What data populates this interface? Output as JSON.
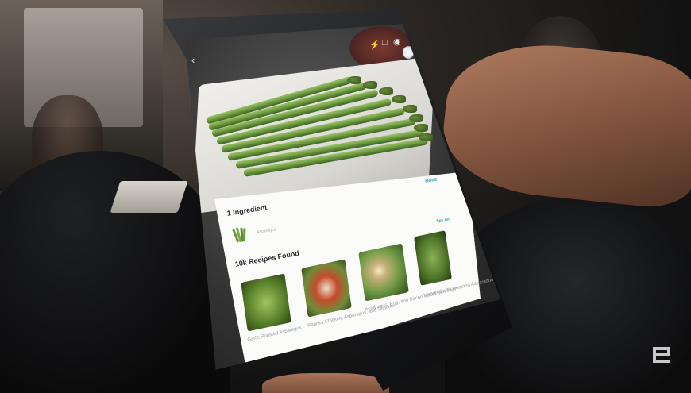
{
  "app": {
    "ingredients_heading": "1 Ingredient",
    "ingredient_name": "Asparagus",
    "see_all_label": "See All",
    "top_right_label": "MORE",
    "recipes_heading": "10k Recipes Found",
    "back_icon": "chevron-left-icon",
    "toolbar_icons": [
      "flash-icon",
      "square-icon",
      "settings-icon"
    ],
    "recipes": [
      {
        "caption": "Garlic Roasted Asparagus"
      },
      {
        "caption": "Paprika Chicken, Asparagus, and Shallots"
      },
      {
        "caption": "Asparagus, Egg, and Bacon Salad with Dijon"
      },
      {
        "caption": "Lemon Garlic Roasted Asparagus"
      }
    ]
  },
  "colors": {
    "accent": "#2aa2b7",
    "panel": "#fbfbfa",
    "asparagus": "#6e9a3e"
  }
}
